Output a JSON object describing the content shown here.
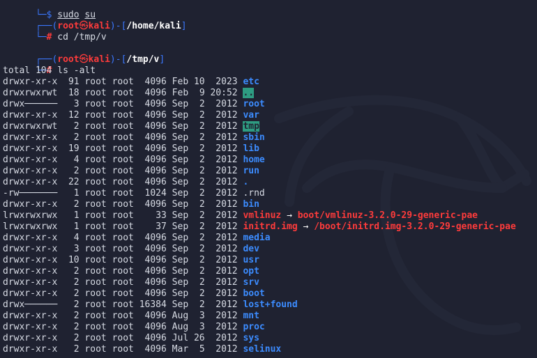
{
  "prompt_top": {
    "prefix": "└─",
    "symbol": "$",
    "cmd_main": "sudo",
    "cmd_arg": "su"
  },
  "prompt1": {
    "frame_open": "┌──(",
    "user": "root",
    "skull": "㉿",
    "host": "kali",
    "frame_mid": ")-[",
    "path": "/home/kali",
    "frame_close": "]",
    "prefix2": "└─",
    "symbol": "#",
    "command": "cd /tmp/v"
  },
  "prompt2": {
    "frame_open": "┌──(",
    "user": "root",
    "skull": "㉿",
    "host": "kali",
    "frame_mid": ")-[",
    "path": "/tmp/v",
    "frame_close": "]",
    "prefix2": "└─",
    "symbol": "#",
    "command": "ls -alt"
  },
  "total": "total 104",
  "listing": [
    {
      "perm": "drwxr-xr-x",
      "links": "91",
      "owner": "root",
      "group": "root",
      "size": "4096",
      "month": "Feb",
      "day": "10",
      "time": "2023",
      "name": "etc",
      "kind": "dir"
    },
    {
      "perm": "drwxrwxrwt",
      "links": "18",
      "owner": "root",
      "group": "root",
      "size": "4096",
      "month": "Feb",
      "day": "9",
      "time": "20:52",
      "name": "..",
      "kind": "hl"
    },
    {
      "perm": "drwx──────",
      "links": "3",
      "owner": "root",
      "group": "root",
      "size": "4096",
      "month": "Sep",
      "day": "2",
      "time": "2012",
      "name": "root",
      "kind": "dir"
    },
    {
      "perm": "drwxr-xr-x",
      "links": "12",
      "owner": "root",
      "group": "root",
      "size": "4096",
      "month": "Sep",
      "day": "2",
      "time": "2012",
      "name": "var",
      "kind": "dir"
    },
    {
      "perm": "drwxrwxrwt",
      "links": "2",
      "owner": "root",
      "group": "root",
      "size": "4096",
      "month": "Sep",
      "day": "2",
      "time": "2012",
      "name": "tmp",
      "kind": "hl"
    },
    {
      "perm": "drwxr-xr-x",
      "links": "2",
      "owner": "root",
      "group": "root",
      "size": "4096",
      "month": "Sep",
      "day": "2",
      "time": "2012",
      "name": "sbin",
      "kind": "dir"
    },
    {
      "perm": "drwxr-xr-x",
      "links": "19",
      "owner": "root",
      "group": "root",
      "size": "4096",
      "month": "Sep",
      "day": "2",
      "time": "2012",
      "name": "lib",
      "kind": "dir"
    },
    {
      "perm": "drwxr-xr-x",
      "links": "4",
      "owner": "root",
      "group": "root",
      "size": "4096",
      "month": "Sep",
      "day": "2",
      "time": "2012",
      "name": "home",
      "kind": "dir"
    },
    {
      "perm": "drwxr-xr-x",
      "links": "2",
      "owner": "root",
      "group": "root",
      "size": "4096",
      "month": "Sep",
      "day": "2",
      "time": "2012",
      "name": "run",
      "kind": "dir"
    },
    {
      "perm": "drwxr-xr-x",
      "links": "22",
      "owner": "root",
      "group": "root",
      "size": "4096",
      "month": "Sep",
      "day": "2",
      "time": "2012",
      "name": ".",
      "kind": "dir"
    },
    {
      "perm": "-rw───────",
      "links": "1",
      "owner": "root",
      "group": "root",
      "size": "1024",
      "month": "Sep",
      "day": "2",
      "time": "2012",
      "name": ".rnd",
      "kind": "file"
    },
    {
      "perm": "drwxr-xr-x",
      "links": "2",
      "owner": "root",
      "group": "root",
      "size": "4096",
      "month": "Sep",
      "day": "2",
      "time": "2012",
      "name": "bin",
      "kind": "dir"
    },
    {
      "perm": "lrwxrwxrwx",
      "links": "1",
      "owner": "root",
      "group": "root",
      "size": "33",
      "month": "Sep",
      "day": "2",
      "time": "2012",
      "name": "vmlinuz",
      "kind": "link",
      "arrow": "→",
      "target": "boot/vmlinuz-3.2.0-29-generic-pae"
    },
    {
      "perm": "lrwxrwxrwx",
      "links": "1",
      "owner": "root",
      "group": "root",
      "size": "37",
      "month": "Sep",
      "day": "2",
      "time": "2012",
      "name": "initrd.img",
      "kind": "link",
      "arrow": "→",
      "target": "/boot/initrd.img-3.2.0-29-generic-pae"
    },
    {
      "perm": "drwxr-xr-x",
      "links": "4",
      "owner": "root",
      "group": "root",
      "size": "4096",
      "month": "Sep",
      "day": "2",
      "time": "2012",
      "name": "media",
      "kind": "dir"
    },
    {
      "perm": "drwxr-xr-x",
      "links": "3",
      "owner": "root",
      "group": "root",
      "size": "4096",
      "month": "Sep",
      "day": "2",
      "time": "2012",
      "name": "dev",
      "kind": "dir"
    },
    {
      "perm": "drwxr-xr-x",
      "links": "10",
      "owner": "root",
      "group": "root",
      "size": "4096",
      "month": "Sep",
      "day": "2",
      "time": "2012",
      "name": "usr",
      "kind": "dir"
    },
    {
      "perm": "drwxr-xr-x",
      "links": "2",
      "owner": "root",
      "group": "root",
      "size": "4096",
      "month": "Sep",
      "day": "2",
      "time": "2012",
      "name": "opt",
      "kind": "dir"
    },
    {
      "perm": "drwxr-xr-x",
      "links": "2",
      "owner": "root",
      "group": "root",
      "size": "4096",
      "month": "Sep",
      "day": "2",
      "time": "2012",
      "name": "srv",
      "kind": "dir"
    },
    {
      "perm": "drwxr-xr-x",
      "links": "2",
      "owner": "root",
      "group": "root",
      "size": "4096",
      "month": "Sep",
      "day": "2",
      "time": "2012",
      "name": "boot",
      "kind": "dir"
    },
    {
      "perm": "drwx──────",
      "links": "2",
      "owner": "root",
      "group": "root",
      "size": "16384",
      "month": "Sep",
      "day": "2",
      "time": "2012",
      "name": "lost+found",
      "kind": "dir"
    },
    {
      "perm": "drwxr-xr-x",
      "links": "2",
      "owner": "root",
      "group": "root",
      "size": "4096",
      "month": "Aug",
      "day": "3",
      "time": "2012",
      "name": "mnt",
      "kind": "dir"
    },
    {
      "perm": "drwxr-xr-x",
      "links": "2",
      "owner": "root",
      "group": "root",
      "size": "4096",
      "month": "Aug",
      "day": "3",
      "time": "2012",
      "name": "proc",
      "kind": "dir"
    },
    {
      "perm": "drwxr-xr-x",
      "links": "2",
      "owner": "root",
      "group": "root",
      "size": "4096",
      "month": "Jul",
      "day": "26",
      "time": "2012",
      "name": "sys",
      "kind": "dir"
    },
    {
      "perm": "drwxr-xr-x",
      "links": "2",
      "owner": "root",
      "group": "root",
      "size": "4096",
      "month": "Mar",
      "day": "5",
      "time": "2012",
      "name": "selinux",
      "kind": "dir"
    }
  ],
  "colors": {
    "background": "#1f2231",
    "frame": "#3b78ff",
    "root_user": "#ff3b3b",
    "directory": "#3c8cff",
    "symlink": "#ff3b3b",
    "highlight_bg": "#2e9c82",
    "text": "#d7dbe4"
  },
  "icons": {
    "watermark": "kali-dragon-icon"
  }
}
